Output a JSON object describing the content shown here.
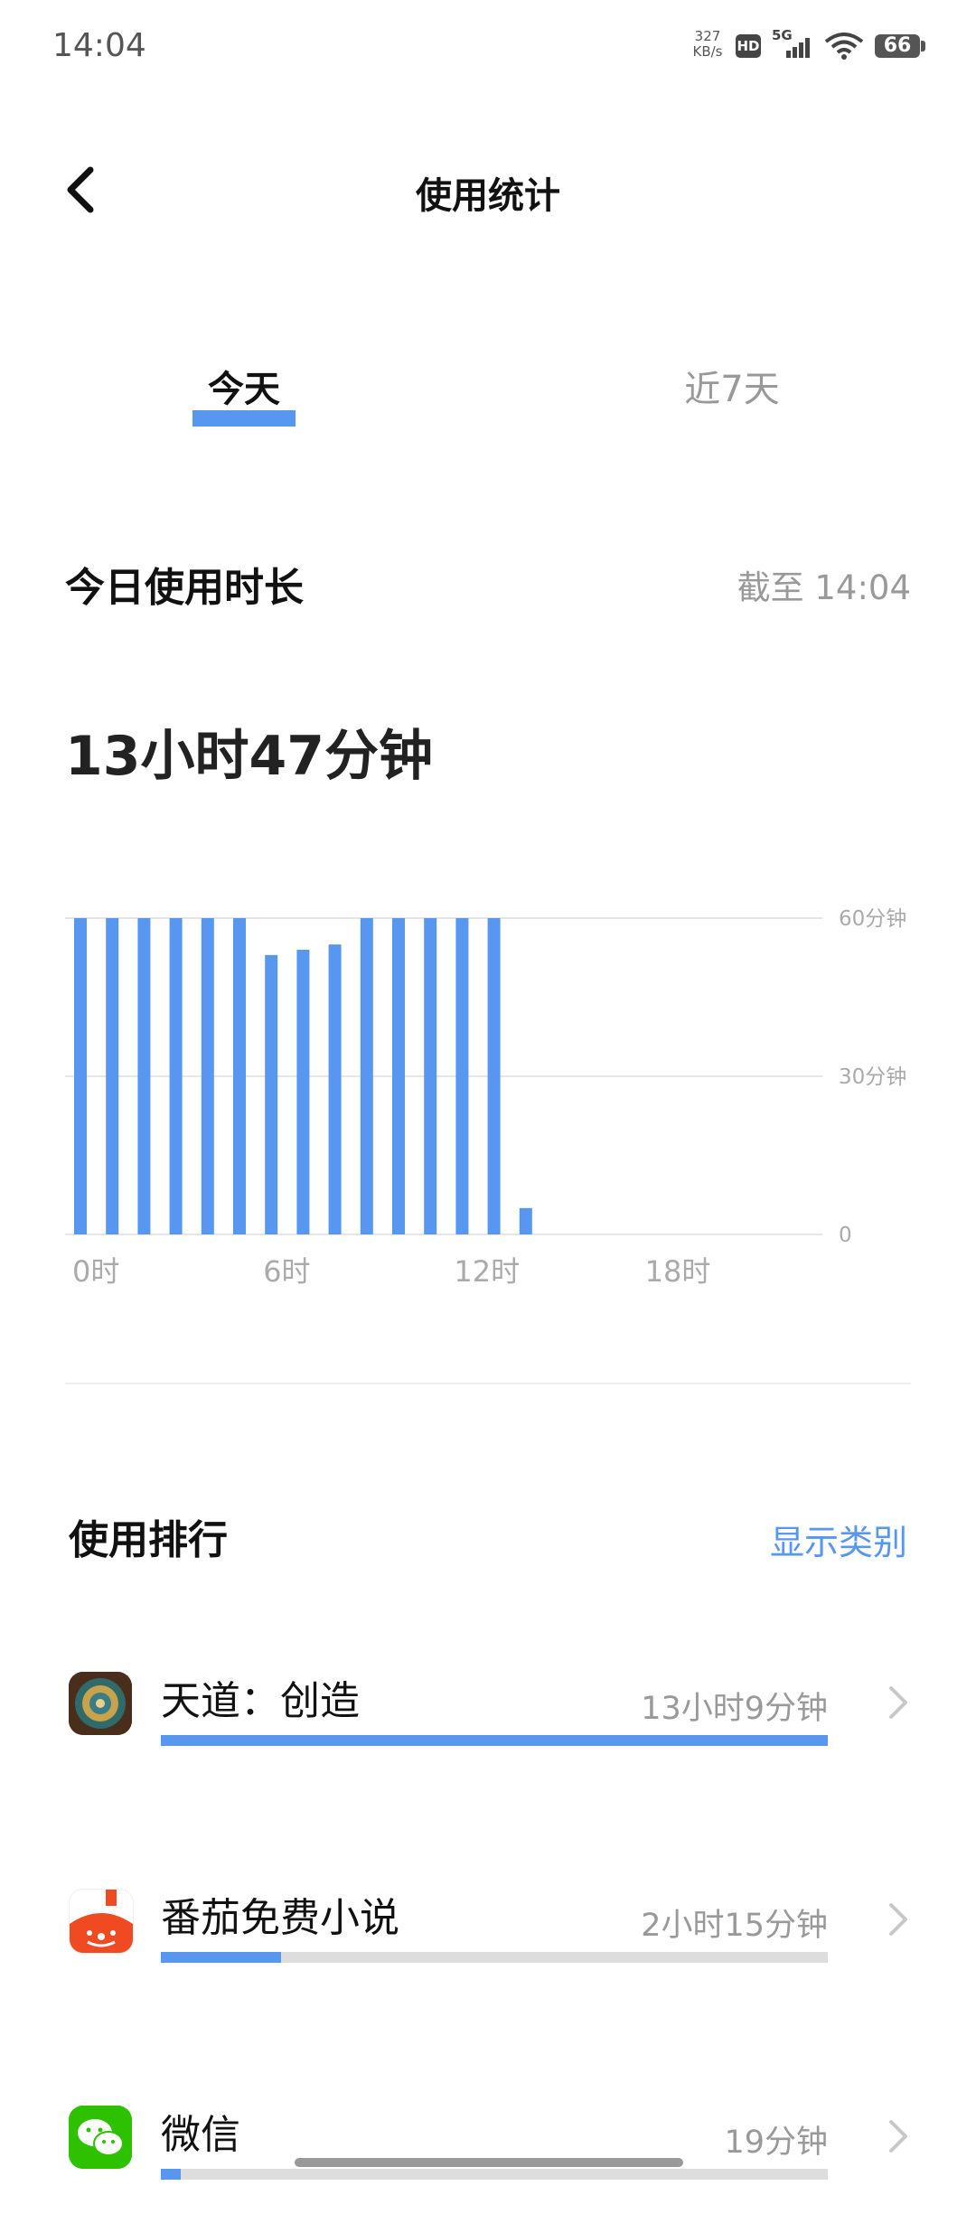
{
  "status_bar": {
    "time": "14:04",
    "net_speed_value": "327",
    "net_speed_unit": "KB/s",
    "hd_label": "HD",
    "network": "5G",
    "battery": "66"
  },
  "header": {
    "title": "使用统计",
    "back_icon": "chevron-left-icon"
  },
  "tabs": [
    {
      "label": "今天",
      "active": true
    },
    {
      "label": "近7天",
      "active": false
    }
  ],
  "today": {
    "label": "今日使用时长",
    "as_of": "截至 14:04",
    "total": "13小时47分钟"
  },
  "chart_data": {
    "type": "bar",
    "x_tick_labels": [
      "0时",
      "6时",
      "12时",
      "18时"
    ],
    "y_tick_labels": [
      "60分钟",
      "30分钟",
      "0"
    ],
    "ylim": [
      0,
      60
    ],
    "hours": [
      0,
      1,
      2,
      3,
      4,
      5,
      6,
      7,
      8,
      9,
      10,
      11,
      12,
      13
    ],
    "values": [
      60,
      60,
      60,
      60,
      60,
      60,
      53,
      54,
      55,
      60,
      60,
      60,
      60,
      60,
      5
    ],
    "color": "#5797ef",
    "grid": true
  },
  "ranking": {
    "title": "使用排行",
    "action": "显示类别",
    "items": [
      {
        "name": "天道：创造",
        "time": "13小时9分钟",
        "fraction": 1.0,
        "icon": "game-app-icon"
      },
      {
        "name": "番茄免费小说",
        "time": "2小时15分钟",
        "fraction": 0.18,
        "icon": "tomato-novel-icon"
      },
      {
        "name": "微信",
        "time": "19分钟",
        "fraction": 0.03,
        "icon": "wechat-icon"
      }
    ]
  },
  "colors": {
    "accent": "#5797ef",
    "muted_text": "#999999",
    "track": "#dddddd"
  }
}
